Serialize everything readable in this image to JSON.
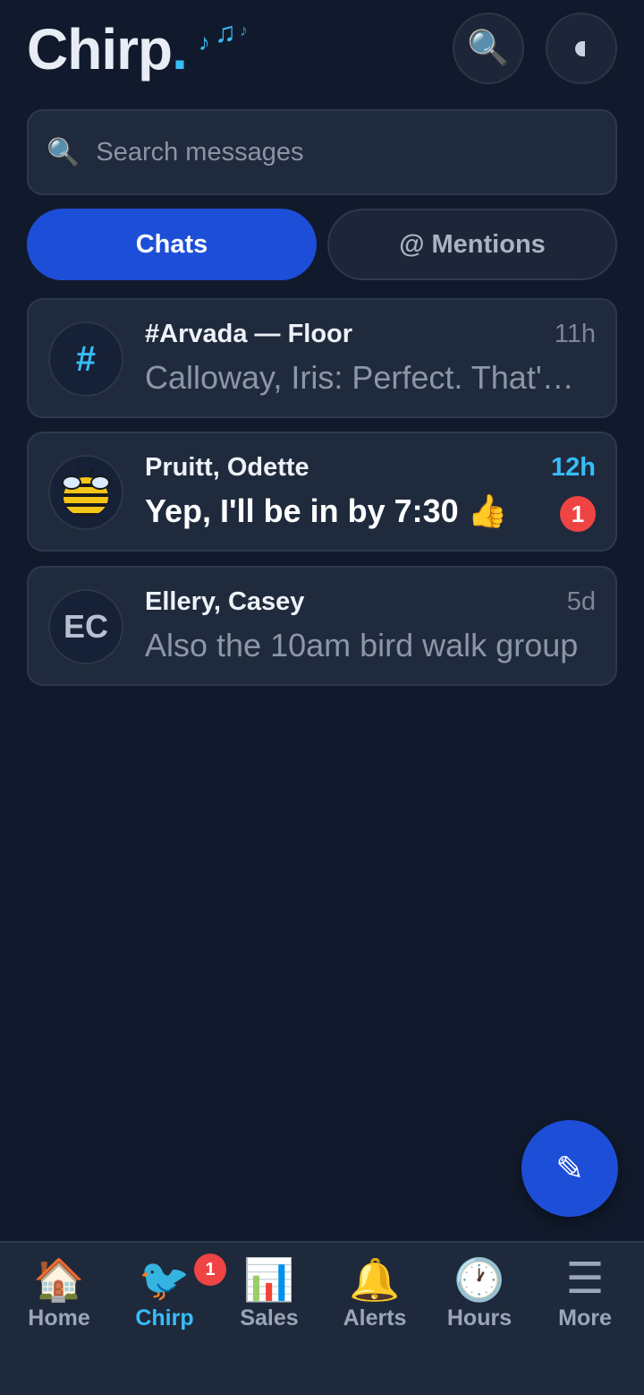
{
  "app": {
    "logo_text": "Chirp",
    "logo_dot": ".",
    "accent_color": "#38bdf8",
    "primary_color": "#1d4ed8",
    "badge_color": "#ef4444"
  },
  "header": {
    "search_icon": "🔍",
    "theme_icon": "half-moon-icon"
  },
  "search": {
    "icon": "🔍",
    "placeholder": "Search messages",
    "value": ""
  },
  "tabs": [
    {
      "label": "Chats",
      "active": true
    },
    {
      "label": "@ Mentions",
      "active": false
    }
  ],
  "chats": [
    {
      "avatar": "#",
      "avatar_type": "channel",
      "name": "#Arvada — Floor",
      "time": "11h",
      "preview": "Calloway, Iris: Perfect. That's great",
      "unread": 0
    },
    {
      "avatar": "bee-icon",
      "avatar_type": "image",
      "name": "Pruitt, Odette",
      "time": "12h",
      "preview": "Yep, I'll be in by 7:30 👍",
      "unread": "1"
    },
    {
      "avatar": "EC",
      "avatar_type": "initials",
      "name": "Ellery, Casey",
      "time": "5d",
      "preview": "Also the 10am bird walk group",
      "unread": 0
    }
  ],
  "fab": {
    "icon": "✎"
  },
  "nav": [
    {
      "icon": "🏠",
      "label": "Home"
    },
    {
      "icon": "🐦",
      "label": "Chirp",
      "badge": "1",
      "active": true
    },
    {
      "icon": "📊",
      "label": "Sales"
    },
    {
      "icon": "🔔",
      "label": "Alerts"
    },
    {
      "icon": "🕐",
      "label": "Hours"
    },
    {
      "icon": "☰",
      "label": "More"
    }
  ]
}
